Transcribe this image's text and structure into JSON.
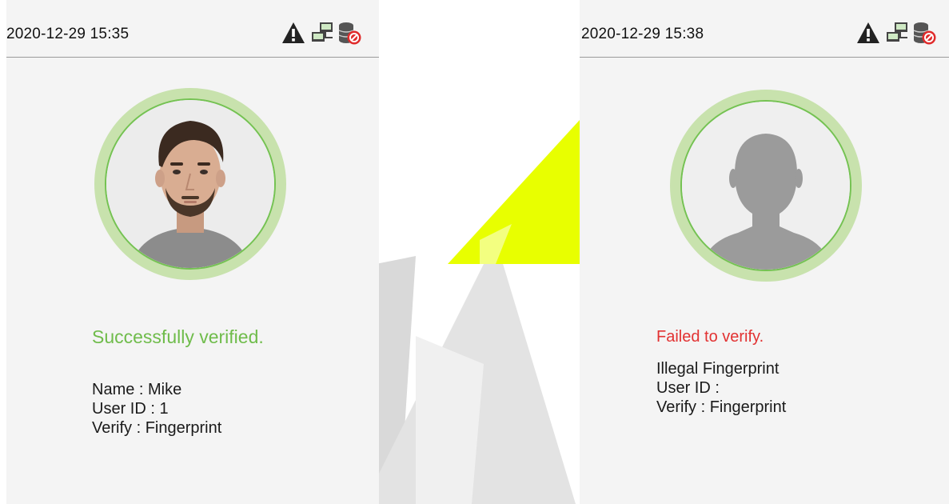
{
  "left_screen": {
    "datetime": "2020-12-29 15:35",
    "status_icons": [
      "warning-icon",
      "network-icon",
      "server-disconnected-icon"
    ],
    "avatar": "user-face-photo",
    "result_message": "Successfully verified.",
    "result_color": "#6fbc4b",
    "name_line": "Name : Mike",
    "user_id_line": "User ID : 1",
    "verify_line": "Verify : Fingerprint"
  },
  "right_screen": {
    "datetime": "2020-12-29 15:38",
    "status_icons": [
      "warning-icon",
      "network-icon",
      "server-disconnected-icon"
    ],
    "avatar": "default-user-silhouette",
    "result_message": "Failed to verify.",
    "result_color": "#e23232",
    "detail_line": "Illegal Fingerprint",
    "user_id_line": "User ID :",
    "verify_line": "Verify : Fingerprint"
  },
  "colors": {
    "ring_outer": "#c8e2ad",
    "ring_inner": "#74c252",
    "watermark_yellow": "#e8ff00",
    "watermark_gray": "#d9d9d9"
  }
}
